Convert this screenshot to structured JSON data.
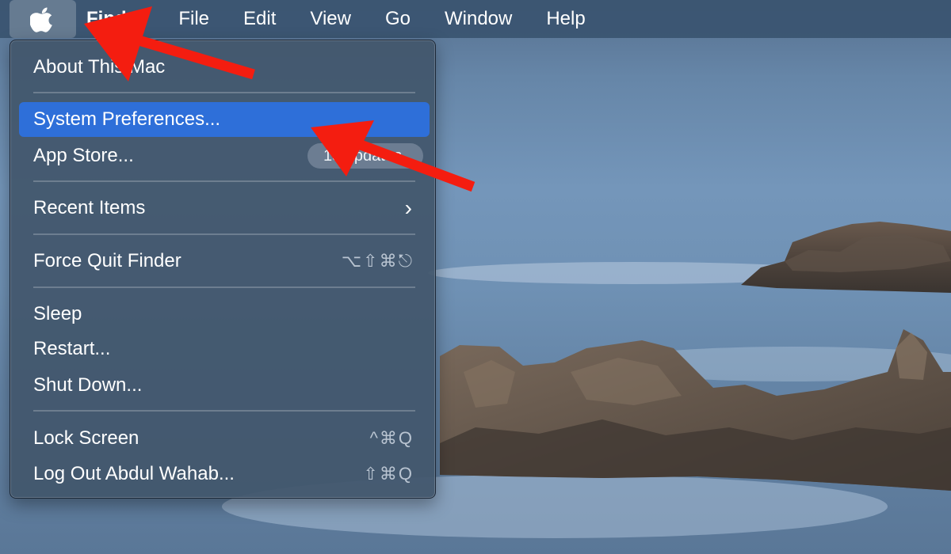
{
  "menubar": {
    "apple_icon": "apple-logo-icon",
    "items": [
      {
        "label": "Finder",
        "bold": true
      },
      {
        "label": "File"
      },
      {
        "label": "Edit"
      },
      {
        "label": "View"
      },
      {
        "label": "Go"
      },
      {
        "label": "Window"
      },
      {
        "label": "Help"
      }
    ]
  },
  "apple_menu": {
    "about": "About This Mac",
    "system_preferences": "System Preferences...",
    "app_store": "App Store...",
    "app_store_badge": "15 updates",
    "recent_items": "Recent Items",
    "recent_items_chevron": "›",
    "force_quit": "Force Quit Finder",
    "force_quit_shortcut": "⌥⇧⌘⎋",
    "sleep": "Sleep",
    "restart": "Restart...",
    "shut_down": "Shut Down...",
    "lock_screen": "Lock Screen",
    "lock_screen_shortcut": "^⌘Q",
    "log_out": "Log Out Abdul Wahab...",
    "log_out_shortcut": "⇧⌘Q"
  },
  "colors": {
    "highlight": "#2e6fd9",
    "annotation_arrow": "#f41d10"
  }
}
